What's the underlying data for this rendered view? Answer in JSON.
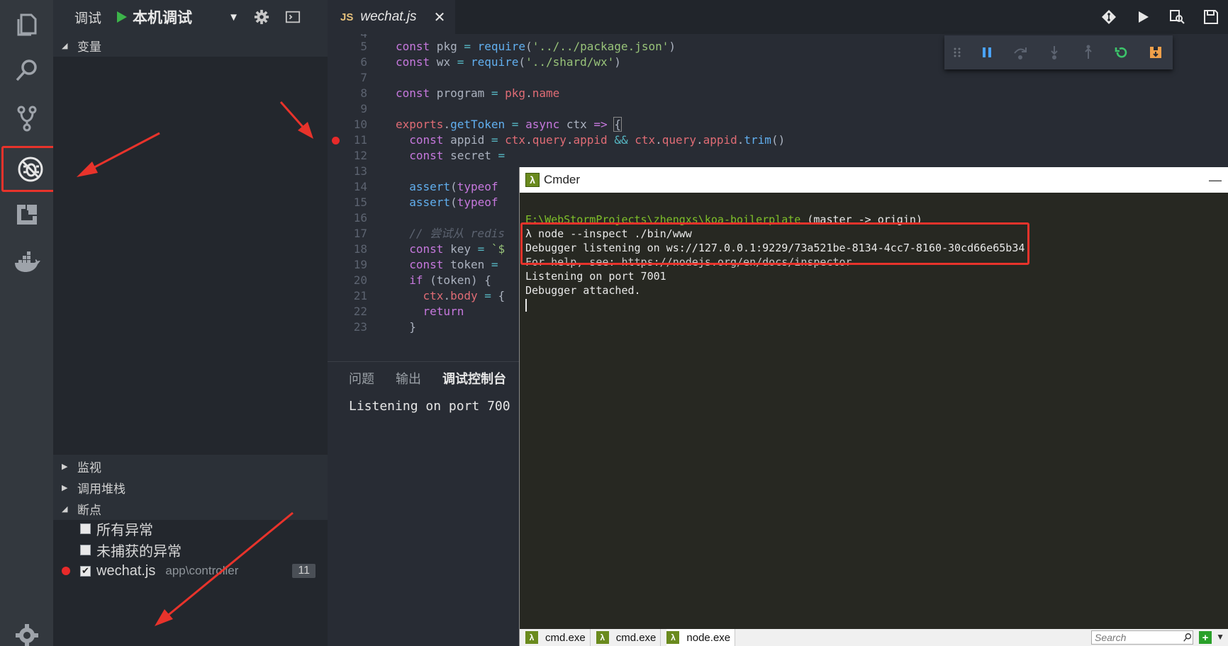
{
  "sidebar": {
    "header_title": "调试",
    "config_name": "本机调试",
    "sections": {
      "variables": "变量",
      "watch": "监视",
      "callstack": "调用堆栈",
      "breakpoints": "断点"
    },
    "breakpoints": [
      {
        "label": "所有异常",
        "checked": false
      },
      {
        "label": "未捕获的异常",
        "checked": false
      }
    ],
    "file_breakpoint": {
      "file": "wechat.js",
      "path": "app\\controller",
      "line": "11"
    }
  },
  "tab": {
    "badge": "JS",
    "name": "wechat.js",
    "close": "✕"
  },
  "code_lines": [
    {
      "n": "4"
    },
    {
      "n": "5"
    },
    {
      "n": "6"
    },
    {
      "n": "7"
    },
    {
      "n": "8"
    },
    {
      "n": "9"
    },
    {
      "n": "10"
    },
    {
      "n": "11"
    },
    {
      "n": "12"
    },
    {
      "n": "13"
    },
    {
      "n": "14"
    },
    {
      "n": "15"
    },
    {
      "n": "16"
    },
    {
      "n": "17"
    },
    {
      "n": "18"
    },
    {
      "n": "19"
    },
    {
      "n": "20"
    },
    {
      "n": "21"
    },
    {
      "n": "22"
    },
    {
      "n": "23"
    }
  ],
  "panel": {
    "tabs": [
      "问题",
      "输出",
      "调试控制台"
    ],
    "console_line": "Listening on port 700"
  },
  "cmder": {
    "title": "Cmder",
    "minimize": "—",
    "prompt_path": "E:\\WebStormProjects\\zhengxs\\koa-boilerplate",
    "prompt_branch": " (master -> origin)",
    "lines": [
      "λ node --inspect ./bin/www",
      "Debugger listening on ws://127.0.0.1:9229/73a521be-8134-4cc7-8160-30cd66e65b34",
      "For help, see: https://nodejs.org/en/docs/inspector",
      "Listening on port 7001",
      "Debugger attached."
    ],
    "tabs": [
      "cmd.exe",
      "cmd.exe",
      "node.exe"
    ],
    "search_placeholder": "Search",
    "tab_icon": "λ",
    "plus": "+"
  }
}
